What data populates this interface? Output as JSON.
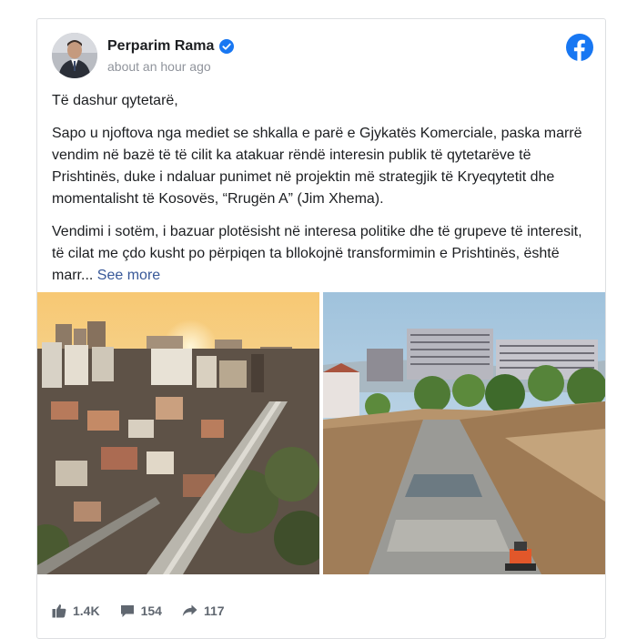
{
  "post": {
    "author": "Perparim Rama",
    "timestamp": "about an hour ago",
    "paragraphs": [
      "Të dashur qytetarë,",
      "Sapo u njoftova nga mediet se shkalla e parë e Gjykatës Komerciale, paska marrë vendim në bazë të të cilit ka atakuar rëndë interesin publik të qytetarëve të Prishtinës, duke i ndaluar punimet në projektin më strategjik të Kryeqytetit dhe momentalisht të Kosovës, “Rrugën A” (Jim Xhema).",
      "Vendimi i sotëm, i bazuar plotësisht në interesa politike dhe të grupeve të interesit, të cilat me çdo kusht po përpiqen ta bllokojnë transformimin e Prishtinës, është marr..."
    ],
    "see_more": "See more"
  },
  "stats": {
    "likes": "1.4K",
    "comments": "154",
    "shares": "117"
  },
  "colors": {
    "facebook_blue": "#1877f2",
    "link": "#385898",
    "muted": "#90949c"
  },
  "icons": [
    "verified-badge-icon",
    "facebook-logo-icon",
    "like-icon",
    "comment-icon",
    "share-icon"
  ]
}
